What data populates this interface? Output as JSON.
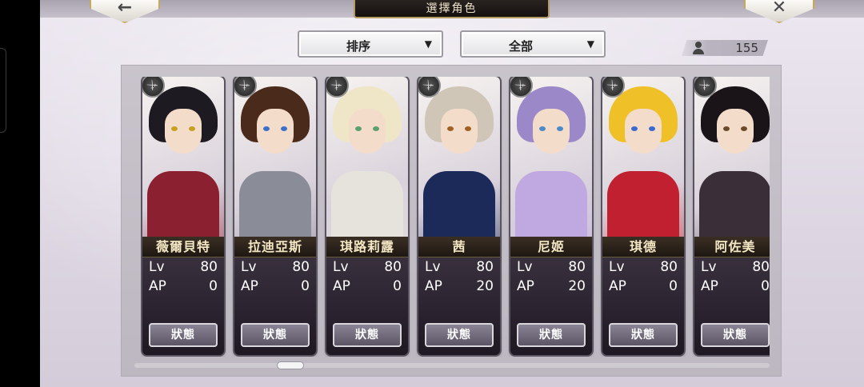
{
  "header": {
    "title": "選擇角色",
    "back_icon": "←",
    "close_icon": "✕"
  },
  "filters": {
    "sort_label": "排序",
    "category_label": "全部",
    "caret": "▼"
  },
  "roster_count": "155",
  "characters": [
    {
      "name": "薇爾貝特",
      "lv": "80",
      "ap": "0",
      "hair": "#1e1a22",
      "eye": "#c8a020",
      "body": "#8a2030"
    },
    {
      "name": "拉迪亞斯",
      "lv": "80",
      "ap": "0",
      "hair": "#4a2a1a",
      "eye": "#3a70c8",
      "body": "#8a8c98"
    },
    {
      "name": "琪路莉露",
      "lv": "80",
      "ap": "0",
      "hair": "#efe6c8",
      "eye": "#5aa070",
      "body": "#e6e2dc"
    },
    {
      "name": "茜",
      "lv": "80",
      "ap": "20",
      "hair": "#cfc6b8",
      "eye": "#a06020",
      "body": "#1c2a5a"
    },
    {
      "name": "尼姬",
      "lv": "80",
      "ap": "20",
      "hair": "#9a88c8",
      "eye": "#4a8ac8",
      "body": "#c0a8e0"
    },
    {
      "name": "琪德",
      "lv": "80",
      "ap": "0",
      "hair": "#f0c028",
      "eye": "#3a6ad0",
      "body": "#c02030"
    },
    {
      "name": "阿佐美",
      "lv": "80",
      "ap": "0",
      "hair": "#1a1418",
      "eye": "#6a4a2a",
      "body": "#3a2e38"
    }
  ],
  "labels": {
    "lv": "Lv",
    "ap": "AP",
    "status_button": "狀態",
    "sword_icon": "⚔"
  }
}
